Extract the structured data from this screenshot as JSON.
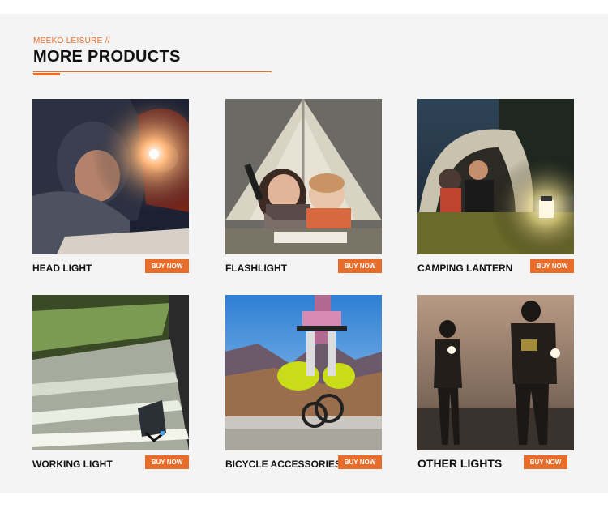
{
  "header": {
    "eyebrow": "MEEKO LEISURE //",
    "title": "MORE PRODUCTS"
  },
  "colors": {
    "accent": "#e96d2a",
    "panel_bg": "#f4f4f4",
    "title": "#111111"
  },
  "products": [
    {
      "label": "HEAD LIGHT",
      "button": "BUY NOW"
    },
    {
      "label": "FLASHLIGHT",
      "button": "BUY NOW"
    },
    {
      "label": "CAMPING LANTERN",
      "button": "BUY NOW"
    },
    {
      "label": "WORKING LIGHT",
      "button": "BUY NOW"
    },
    {
      "label": "BICYCLE ACCESSORIES",
      "button": "BUY NOW"
    },
    {
      "label": "OTHER LIGHTS",
      "button": "BUY NOW"
    }
  ]
}
